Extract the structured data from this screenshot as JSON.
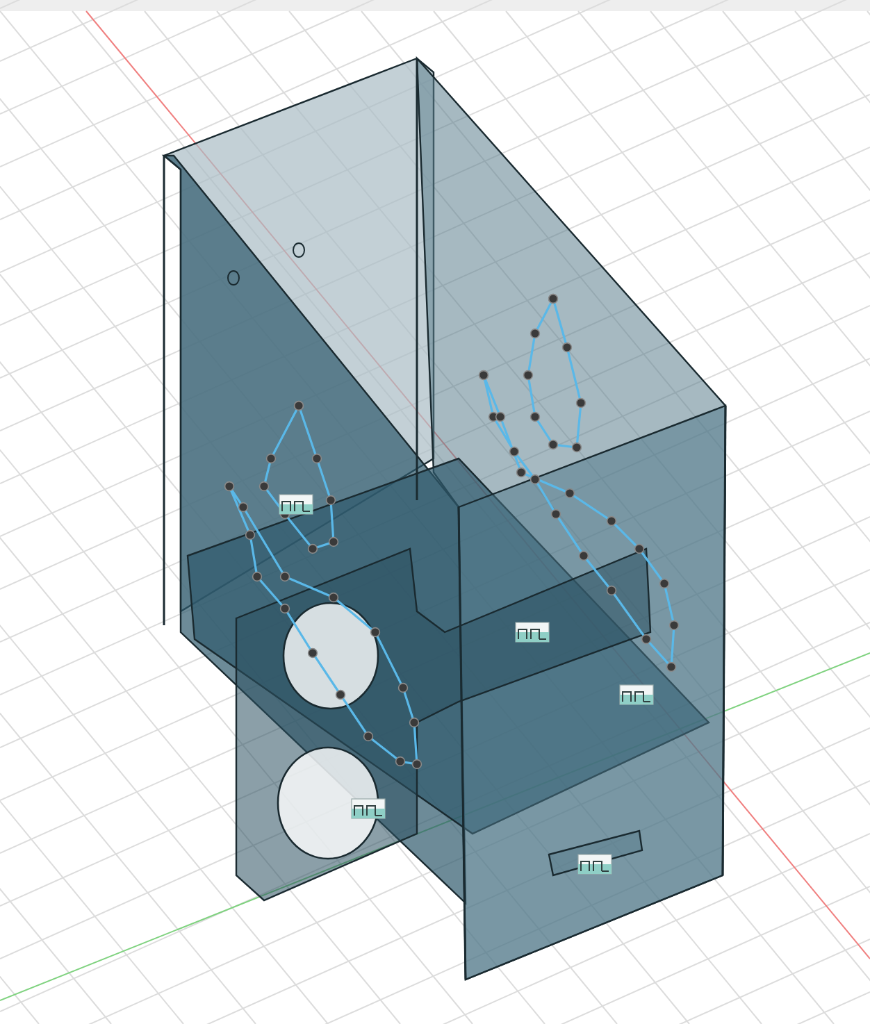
{
  "viewport": {
    "kind": "perspective",
    "grid": true,
    "axes": true
  }
}
